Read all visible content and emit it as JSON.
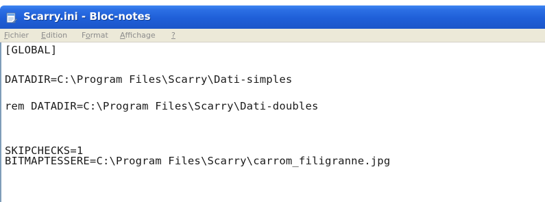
{
  "window": {
    "title": "Scarry.ini - Bloc-notes"
  },
  "icons": {
    "app_icon": "notepad-icon"
  },
  "colors": {
    "titlebar": "#1f5fd8",
    "menubar": "#ece9d8",
    "menu_text": "#8c8c8c",
    "content_text": "#1a1a1a"
  },
  "menu": {
    "items": [
      {
        "mnemonic": "F",
        "rest": "ichier"
      },
      {
        "mnemonic": "E",
        "rest": "dition"
      },
      {
        "pre": "F",
        "mnemonic": "o",
        "rest": "rmat"
      },
      {
        "mnemonic": "A",
        "rest": "ffichage"
      },
      {
        "mnemonic": "?",
        "rest": ""
      }
    ]
  },
  "document": {
    "lines": [
      "[GLOBAL]",
      "DATADIR=C:\\Program Files\\Scarry\\Dati-simples",
      "rem DATADIR=C:\\Program Files\\Scarry\\Dati-doubles",
      "SKIPCHECKS=1",
      "BITMAPTESSERE=C:\\Program Files\\Scarry\\carrom_filigranne.jpg"
    ]
  }
}
